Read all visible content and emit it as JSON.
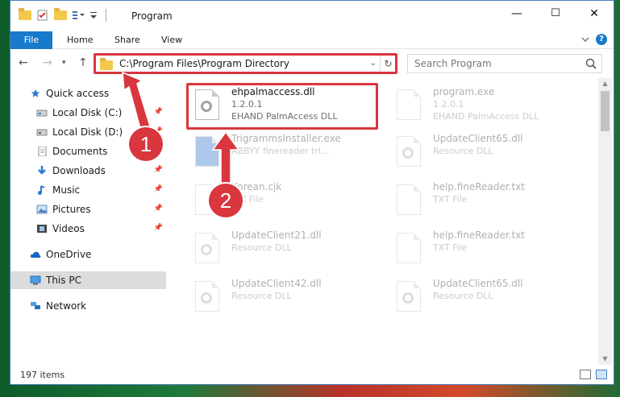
{
  "window": {
    "title": "Program"
  },
  "ribbon": {
    "tabs": [
      "File",
      "Home",
      "Share",
      "View"
    ]
  },
  "address": {
    "path": "C:\\Program Files\\Program Directory"
  },
  "search": {
    "placeholder": "Search Program"
  },
  "sidebar": {
    "items": [
      {
        "label": "Quick access",
        "icon": "star-icon",
        "pinned": false
      },
      {
        "label": "Local Disk (C:)",
        "icon": "drive-icon",
        "pinned": true
      },
      {
        "label": "Local Disk (D:)",
        "icon": "drive-icon",
        "pinned": true
      },
      {
        "label": "Documents",
        "icon": "documents-icon",
        "pinned": true
      },
      {
        "label": "Downloads",
        "icon": "download-icon",
        "pinned": true
      },
      {
        "label": "Music",
        "icon": "music-icon",
        "pinned": true
      },
      {
        "label": "Pictures",
        "icon": "pictures-icon",
        "pinned": true
      },
      {
        "label": "Videos",
        "icon": "videos-icon",
        "pinned": true
      },
      {
        "label": "OneDrive",
        "icon": "cloud-icon",
        "pinned": false
      },
      {
        "label": "This PC",
        "icon": "computer-icon",
        "pinned": false,
        "selected": true
      },
      {
        "label": "Network",
        "icon": "network-icon",
        "pinned": false
      }
    ]
  },
  "files": [
    {
      "name": "ehpalmaccess.dll",
      "line2": "1.2.0.1",
      "line3": "EHAND PalmAccess  DLL",
      "highlight": true
    },
    {
      "name": "program.exe",
      "line2": "1.2.0.1",
      "line3": "EHAND PalmAccess  DLL"
    },
    {
      "name": "TrigrammsInstaller.exe",
      "line2": "ABBYY finereader tri...",
      "line3": ""
    },
    {
      "name": "UpdateClient65.dll",
      "line2": "Resource DLL",
      "line3": ""
    },
    {
      "name": "Korean.cjk",
      "line2": "CJK File",
      "line3": ""
    },
    {
      "name": "help.fineReader.txt",
      "line2": "TXT File",
      "line3": ""
    },
    {
      "name": "UpdateClient21.dll",
      "line2": "Resource DLL",
      "line3": ""
    },
    {
      "name": "help.fineReader.txt",
      "line2": "TXT File",
      "line3": ""
    },
    {
      "name": "UpdateClient42.dll",
      "line2": "Resource DLL",
      "line3": ""
    },
    {
      "name": "UpdateClient65.dll",
      "line2": "Resource DLL",
      "line3": ""
    }
  ],
  "status": {
    "count": "197 items"
  },
  "annotations": {
    "badge1": "1",
    "badge2": "2",
    "color": "#d9363e"
  },
  "colors": {
    "accent": "#1979ca",
    "highlight": "#d9363e"
  }
}
